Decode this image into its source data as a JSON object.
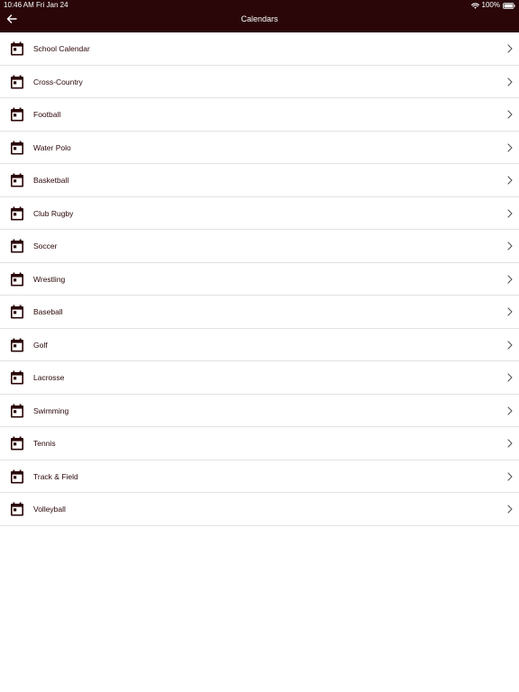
{
  "status_bar": {
    "time": "10:46 AM",
    "date": "Fri Jan 24",
    "battery": "100%",
    "wifi_icon": "wifi-icon",
    "battery_icon": "battery-icon"
  },
  "header": {
    "title": "Calendars",
    "back_icon": "arrow-left-icon"
  },
  "colors": {
    "header_bg": "#2a0608",
    "accent": "#2a0608",
    "divider": "#e2e2e2"
  },
  "calendars": [
    {
      "label": "School Calendar",
      "icon": "calendar-icon"
    },
    {
      "label": "Cross-Country",
      "icon": "calendar-icon"
    },
    {
      "label": "Football",
      "icon": "calendar-icon"
    },
    {
      "label": "Water Polo",
      "icon": "calendar-icon"
    },
    {
      "label": "Basketball",
      "icon": "calendar-icon"
    },
    {
      "label": "Club Rugby",
      "icon": "calendar-icon"
    },
    {
      "label": "Soccer",
      "icon": "calendar-icon"
    },
    {
      "label": "Wrestling",
      "icon": "calendar-icon"
    },
    {
      "label": "Baseball",
      "icon": "calendar-icon"
    },
    {
      "label": "Golf",
      "icon": "calendar-icon"
    },
    {
      "label": "Lacrosse",
      "icon": "calendar-icon"
    },
    {
      "label": "Swimming",
      "icon": "calendar-icon"
    },
    {
      "label": "Tennis",
      "icon": "calendar-icon"
    },
    {
      "label": "Track & Field",
      "icon": "calendar-icon"
    },
    {
      "label": "Volleyball",
      "icon": "calendar-icon"
    }
  ]
}
